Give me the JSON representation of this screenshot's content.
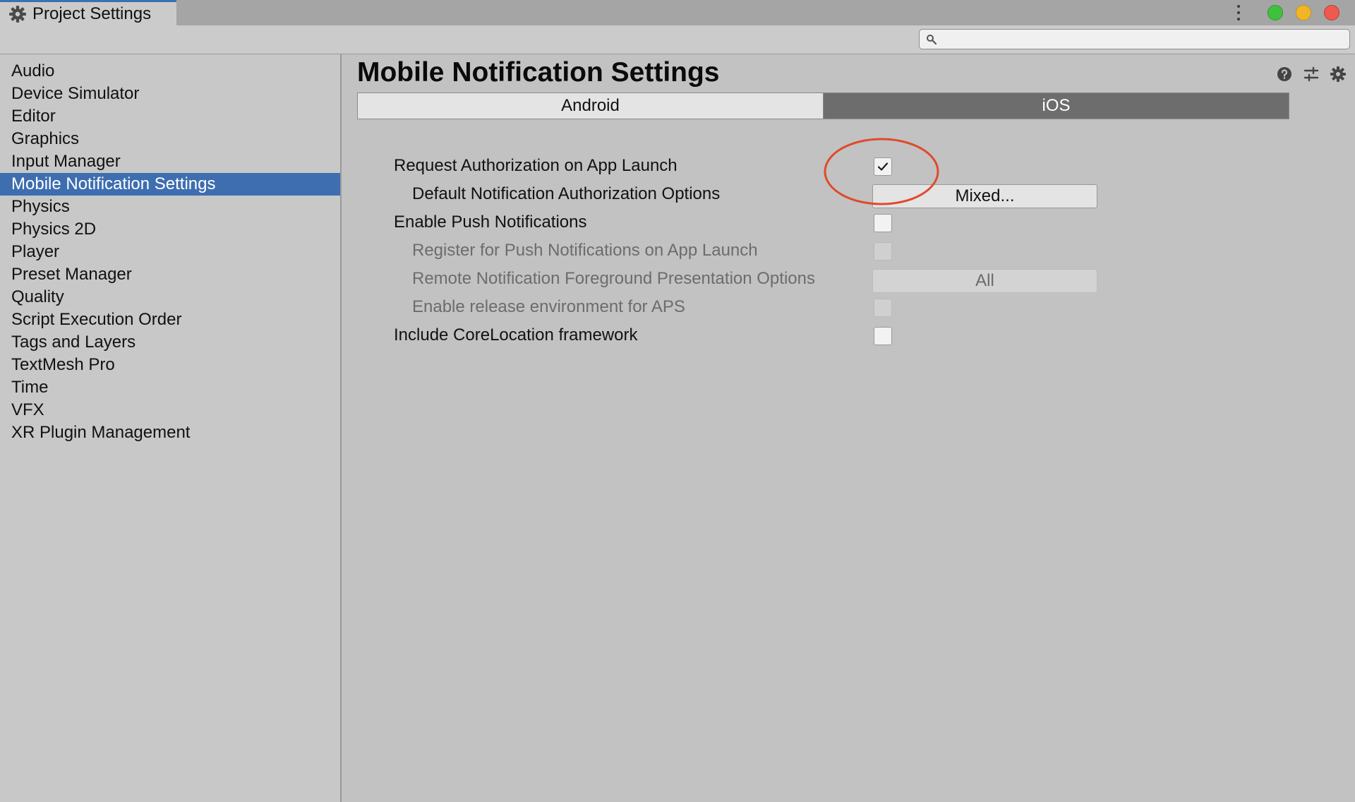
{
  "window": {
    "tab_title": "Project Settings",
    "tab_icon": "gear-icon",
    "traffic_lights": {
      "maximize": "#3fc13f",
      "minimize": "#f3b528",
      "close": "#ee5a4f"
    }
  },
  "search": {
    "placeholder": "",
    "value": ""
  },
  "sidebar": {
    "items": [
      {
        "label": "Audio"
      },
      {
        "label": "Device Simulator"
      },
      {
        "label": "Editor"
      },
      {
        "label": "Graphics"
      },
      {
        "label": "Input Manager"
      },
      {
        "label": "Mobile Notification Settings",
        "selected": true
      },
      {
        "label": "Physics"
      },
      {
        "label": "Physics 2D"
      },
      {
        "label": "Player"
      },
      {
        "label": "Preset Manager"
      },
      {
        "label": "Quality"
      },
      {
        "label": "Script Execution Order"
      },
      {
        "label": "Tags and Layers"
      },
      {
        "label": "TextMesh Pro"
      },
      {
        "label": "Time"
      },
      {
        "label": "VFX"
      },
      {
        "label": "XR Plugin Management"
      }
    ]
  },
  "main": {
    "title": "Mobile Notification Settings",
    "header_icons": [
      "help-icon",
      "sliders-icon",
      "settings-gear-icon"
    ],
    "platform_tabs": [
      {
        "label": "Android",
        "active": false
      },
      {
        "label": "iOS",
        "active": true
      }
    ],
    "settings": [
      {
        "label": "Request Authorization on App Launch",
        "control": "checkbox",
        "checked": true,
        "disabled": false,
        "indent": false
      },
      {
        "label": "Default Notification Authorization Options",
        "control": "dropdown",
        "value": "Mixed...",
        "disabled": false,
        "indent": true
      },
      {
        "label": "Enable Push Notifications",
        "control": "checkbox",
        "checked": false,
        "disabled": false,
        "indent": false
      },
      {
        "label": "Register for Push Notifications on App Launch",
        "control": "checkbox",
        "checked": false,
        "disabled": true,
        "indent": true
      },
      {
        "label": "Remote Notification Foreground Presentation Options",
        "control": "dropdown",
        "value": "All",
        "disabled": true,
        "indent": true
      },
      {
        "label": "Enable release environment for APS",
        "control": "checkbox",
        "checked": false,
        "disabled": true,
        "indent": true
      },
      {
        "label": "Include CoreLocation framework",
        "control": "checkbox",
        "checked": false,
        "disabled": false,
        "indent": false
      }
    ]
  },
  "colors": {
    "selection": "#3e6eb0",
    "active_tab": "#6d6d6d",
    "annotation": "#e04a2c"
  }
}
